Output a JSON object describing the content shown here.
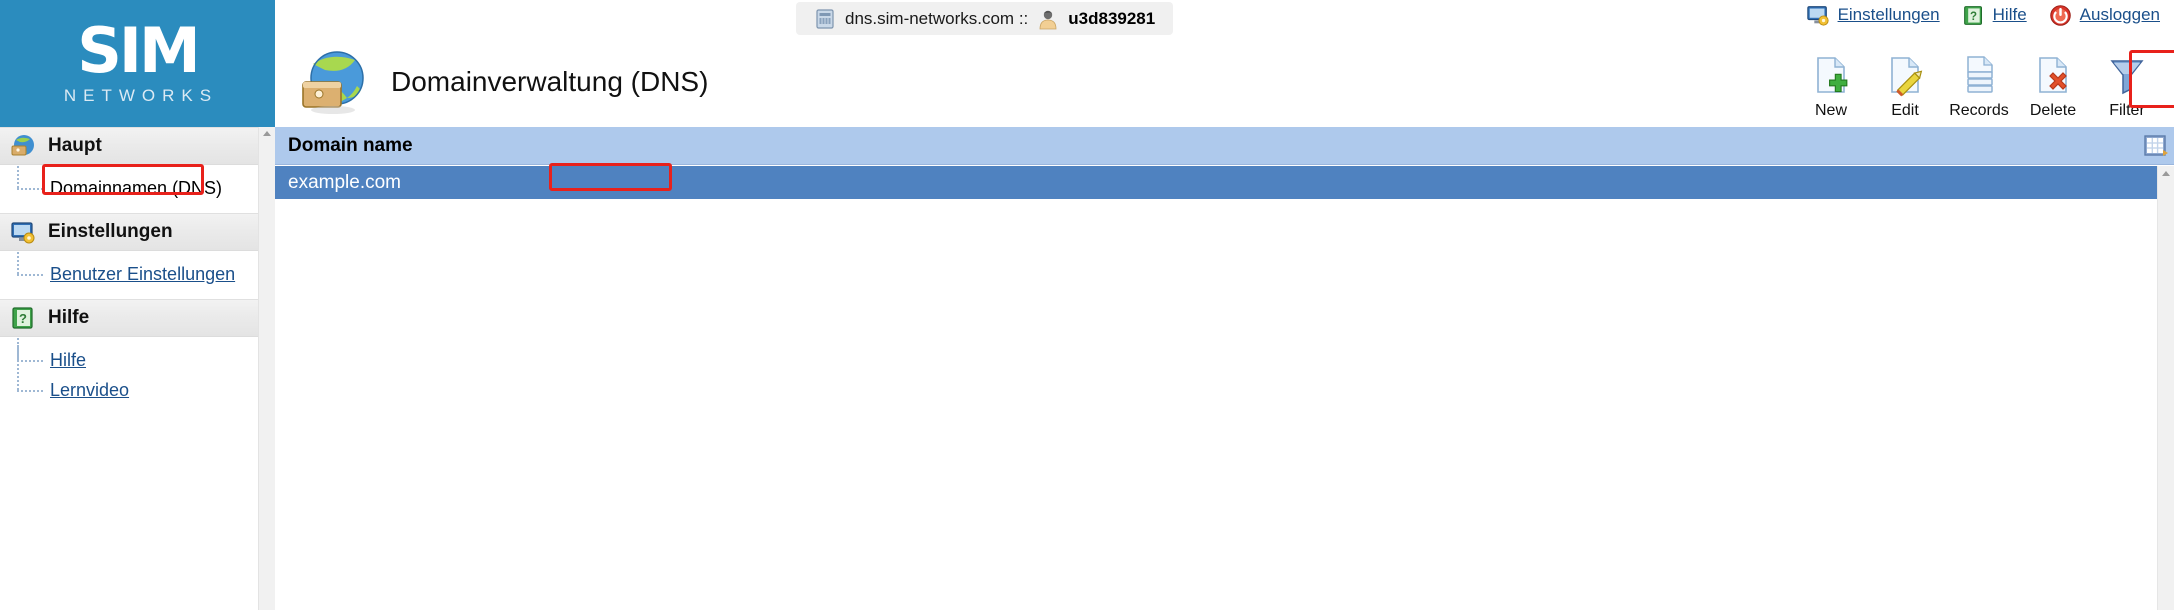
{
  "branding": {
    "logo_primary": "SIM",
    "logo_secondary": "NETWORKS",
    "logo_bg_color": "#2b8cbe"
  },
  "topbar": {
    "server_icon": "server-icon",
    "server_host": "dns.sim-networks.com ::",
    "user_icon": "user-avatar-icon",
    "username": "u3d839281",
    "links": [
      {
        "label": "Einstellungen",
        "icon": "monitor-settings-icon"
      },
      {
        "label": "Hilfe",
        "icon": "green-book-help-icon"
      },
      {
        "label": "Ausloggen",
        "icon": "power-logout-icon"
      }
    ],
    "link_color": "#1a4f8a"
  },
  "header": {
    "title": "Domainverwaltung (DNS)",
    "title_icon": "globe-briefcase-icon"
  },
  "toolbar": {
    "buttons": [
      {
        "label": "New",
        "icon": "page-add-icon",
        "highlighted": false
      },
      {
        "label": "Edit",
        "icon": "page-edit-pencil-icon",
        "highlighted": false
      },
      {
        "label": "Records",
        "icon": "page-stack-icon",
        "highlighted": true
      },
      {
        "label": "Delete",
        "icon": "page-delete-icon",
        "highlighted": false
      },
      {
        "label": "Filter",
        "icon": "funnel-filter-icon",
        "highlighted": false
      }
    ],
    "highlight_color": "#e8211b"
  },
  "sidebar": {
    "groups": [
      {
        "label": "Haupt",
        "icon": "globe-briefcase-icon",
        "items": [
          {
            "label": "Domainnamen (DNS)",
            "style": "plain",
            "highlighted": true
          }
        ]
      },
      {
        "label": "Einstellungen",
        "icon": "monitor-settings-icon",
        "items": [
          {
            "label": "Benutzer Einstellungen",
            "style": "link",
            "highlighted": false
          }
        ]
      },
      {
        "label": "Hilfe",
        "icon": "green-book-help-icon",
        "items": [
          {
            "label": "Hilfe",
            "style": "link",
            "highlighted": false
          },
          {
            "label": "Lernvideo",
            "style": "link",
            "highlighted": false
          }
        ]
      }
    ]
  },
  "grid": {
    "columns": [
      "Domain name"
    ],
    "header_bg": "#aec9ec",
    "selected_row_bg": "#4f82c0",
    "column_chooser_icon": "grid-columns-icon",
    "rows": [
      {
        "domain": "example.com",
        "selected": true,
        "highlighted": true
      }
    ]
  }
}
